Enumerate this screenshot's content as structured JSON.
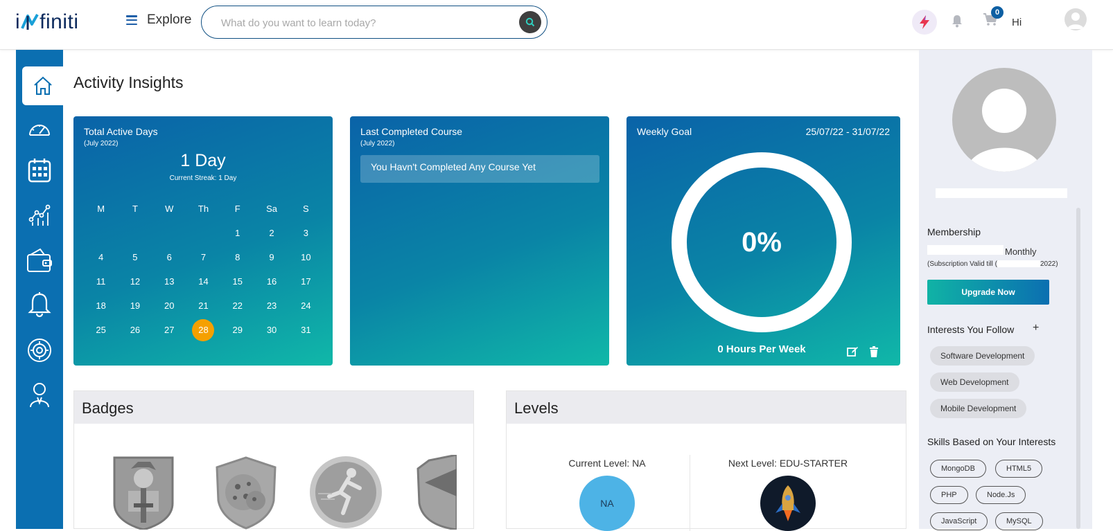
{
  "header": {
    "logo_text": "finiti",
    "logo_prefix": "i",
    "explore_label": "Explore",
    "search_placeholder": "What do you want to learn today?",
    "cart_count": "0",
    "greeting": "Hi",
    "accent": "#0b6fb1"
  },
  "main": {
    "title": "Activity Insights",
    "active_days": {
      "title": "Total Active Days",
      "period": "(July 2022)",
      "value": "1 Day",
      "streak": "Current Streak: 1 Day",
      "weekdays": [
        "M",
        "T",
        "W",
        "Th",
        "F",
        "Sa",
        "S"
      ],
      "weeks": [
        [
          "",
          "",
          "",
          "",
          "1",
          "2",
          "3"
        ],
        [
          "4",
          "5",
          "6",
          "7",
          "8",
          "9",
          "10"
        ],
        [
          "11",
          "12",
          "13",
          "14",
          "15",
          "16",
          "17"
        ],
        [
          "18",
          "19",
          "20",
          "21",
          "22",
          "23",
          "24"
        ],
        [
          "25",
          "26",
          "27",
          "28",
          "29",
          "30",
          "31"
        ]
      ],
      "today": "28",
      "today_color": "#f5a000"
    },
    "last_course": {
      "title": "Last Completed Course",
      "period": "(July 2022)",
      "message": "You Havn't Completed Any Course Yet"
    },
    "weekly_goal": {
      "title": "Weekly Goal",
      "dates": "25/07/22 - 31/07/22",
      "progress": "0%",
      "hours": "0 Hours Per Week"
    },
    "badges": {
      "title": "Badges"
    },
    "levels": {
      "title": "Levels",
      "current_label": "Current Level: NA",
      "current_value": "NA",
      "next_label": "Next Level: EDU-STARTER"
    }
  },
  "sidebar_right": {
    "membership_title": "Membership",
    "plan": "Monthly",
    "valid_prefix": "(Subscription Valid till (",
    "valid_suffix": "2022)",
    "upgrade_label": "Upgrade Now",
    "interests_title": "Interests You Follow",
    "add_symbol": "+",
    "interests": [
      "Software Development",
      "Web Development",
      "Mobile Development"
    ],
    "skills_title": "Skills Based on Your Interests",
    "skills": [
      "MongoDB",
      "HTML5",
      "PHP",
      "Node.Js",
      "JavaScript",
      "MySQL"
    ]
  }
}
